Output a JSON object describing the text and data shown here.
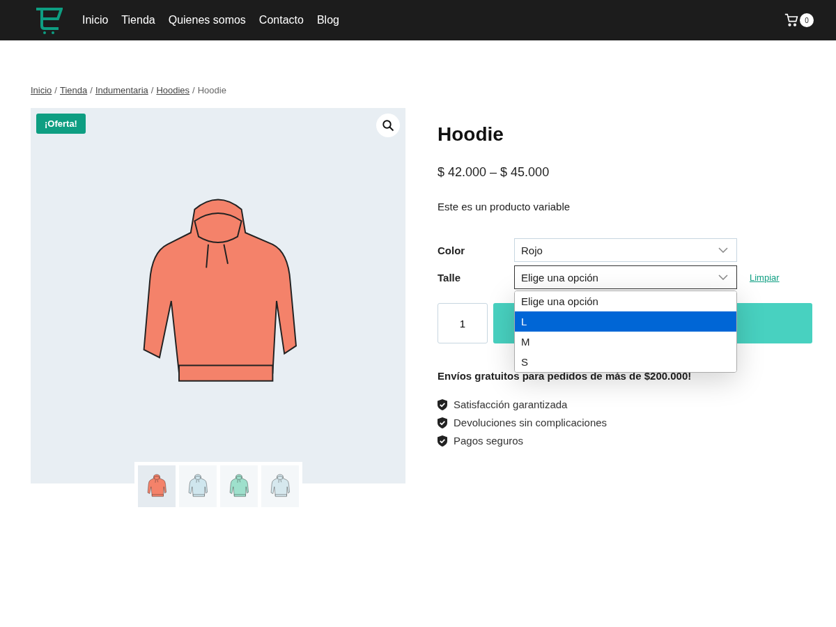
{
  "nav": {
    "items": [
      "Inicio",
      "Tienda",
      "Quienes somos",
      "Contacto",
      "Blog"
    ],
    "cart_count": "0"
  },
  "breadcrumb": [
    {
      "kind": "link",
      "label": "Inicio"
    },
    {
      "kind": "separator",
      "label": "/"
    },
    {
      "kind": "link",
      "label": "Tienda"
    },
    {
      "kind": "separator",
      "label": "/"
    },
    {
      "kind": "link",
      "label": "Indumentaria"
    },
    {
      "kind": "separator",
      "label": "/"
    },
    {
      "kind": "link",
      "label": "Hoodies"
    },
    {
      "kind": "separator",
      "label": "/"
    },
    {
      "kind": "current",
      "label": "Hoodie"
    }
  ],
  "gallery": {
    "badge": "¡Oferta!",
    "thumbnails": [
      {
        "color": "#f4826a",
        "selected": true
      },
      {
        "color": "#cfe6ee",
        "selected": false
      },
      {
        "color": "#9ee0cc",
        "selected": false
      },
      {
        "color": "#d6e8ee",
        "selected": false
      }
    ]
  },
  "product": {
    "title": "Hoodie",
    "price": "$ 42.000 – $ 45.000",
    "description": "Este es un producto variable",
    "variations": [
      {
        "label": "Color",
        "value": "Rojo",
        "open": false
      },
      {
        "label": "Talle",
        "value": "Elige una opción",
        "open": true,
        "reset": "Limpiar",
        "options": [
          {
            "label": "Elige una opción",
            "highlighted": false
          },
          {
            "label": "L",
            "highlighted": true
          },
          {
            "label": "M",
            "highlighted": false
          },
          {
            "label": "S",
            "highlighted": false
          }
        ]
      }
    ],
    "quantity": "1",
    "shipping": "Envíos gratuitos para pedidos de más de $200.000!",
    "features": [
      "Satisfacción garantizada",
      "Devoluciones sin complicaciones",
      "Pagos seguros"
    ]
  }
}
